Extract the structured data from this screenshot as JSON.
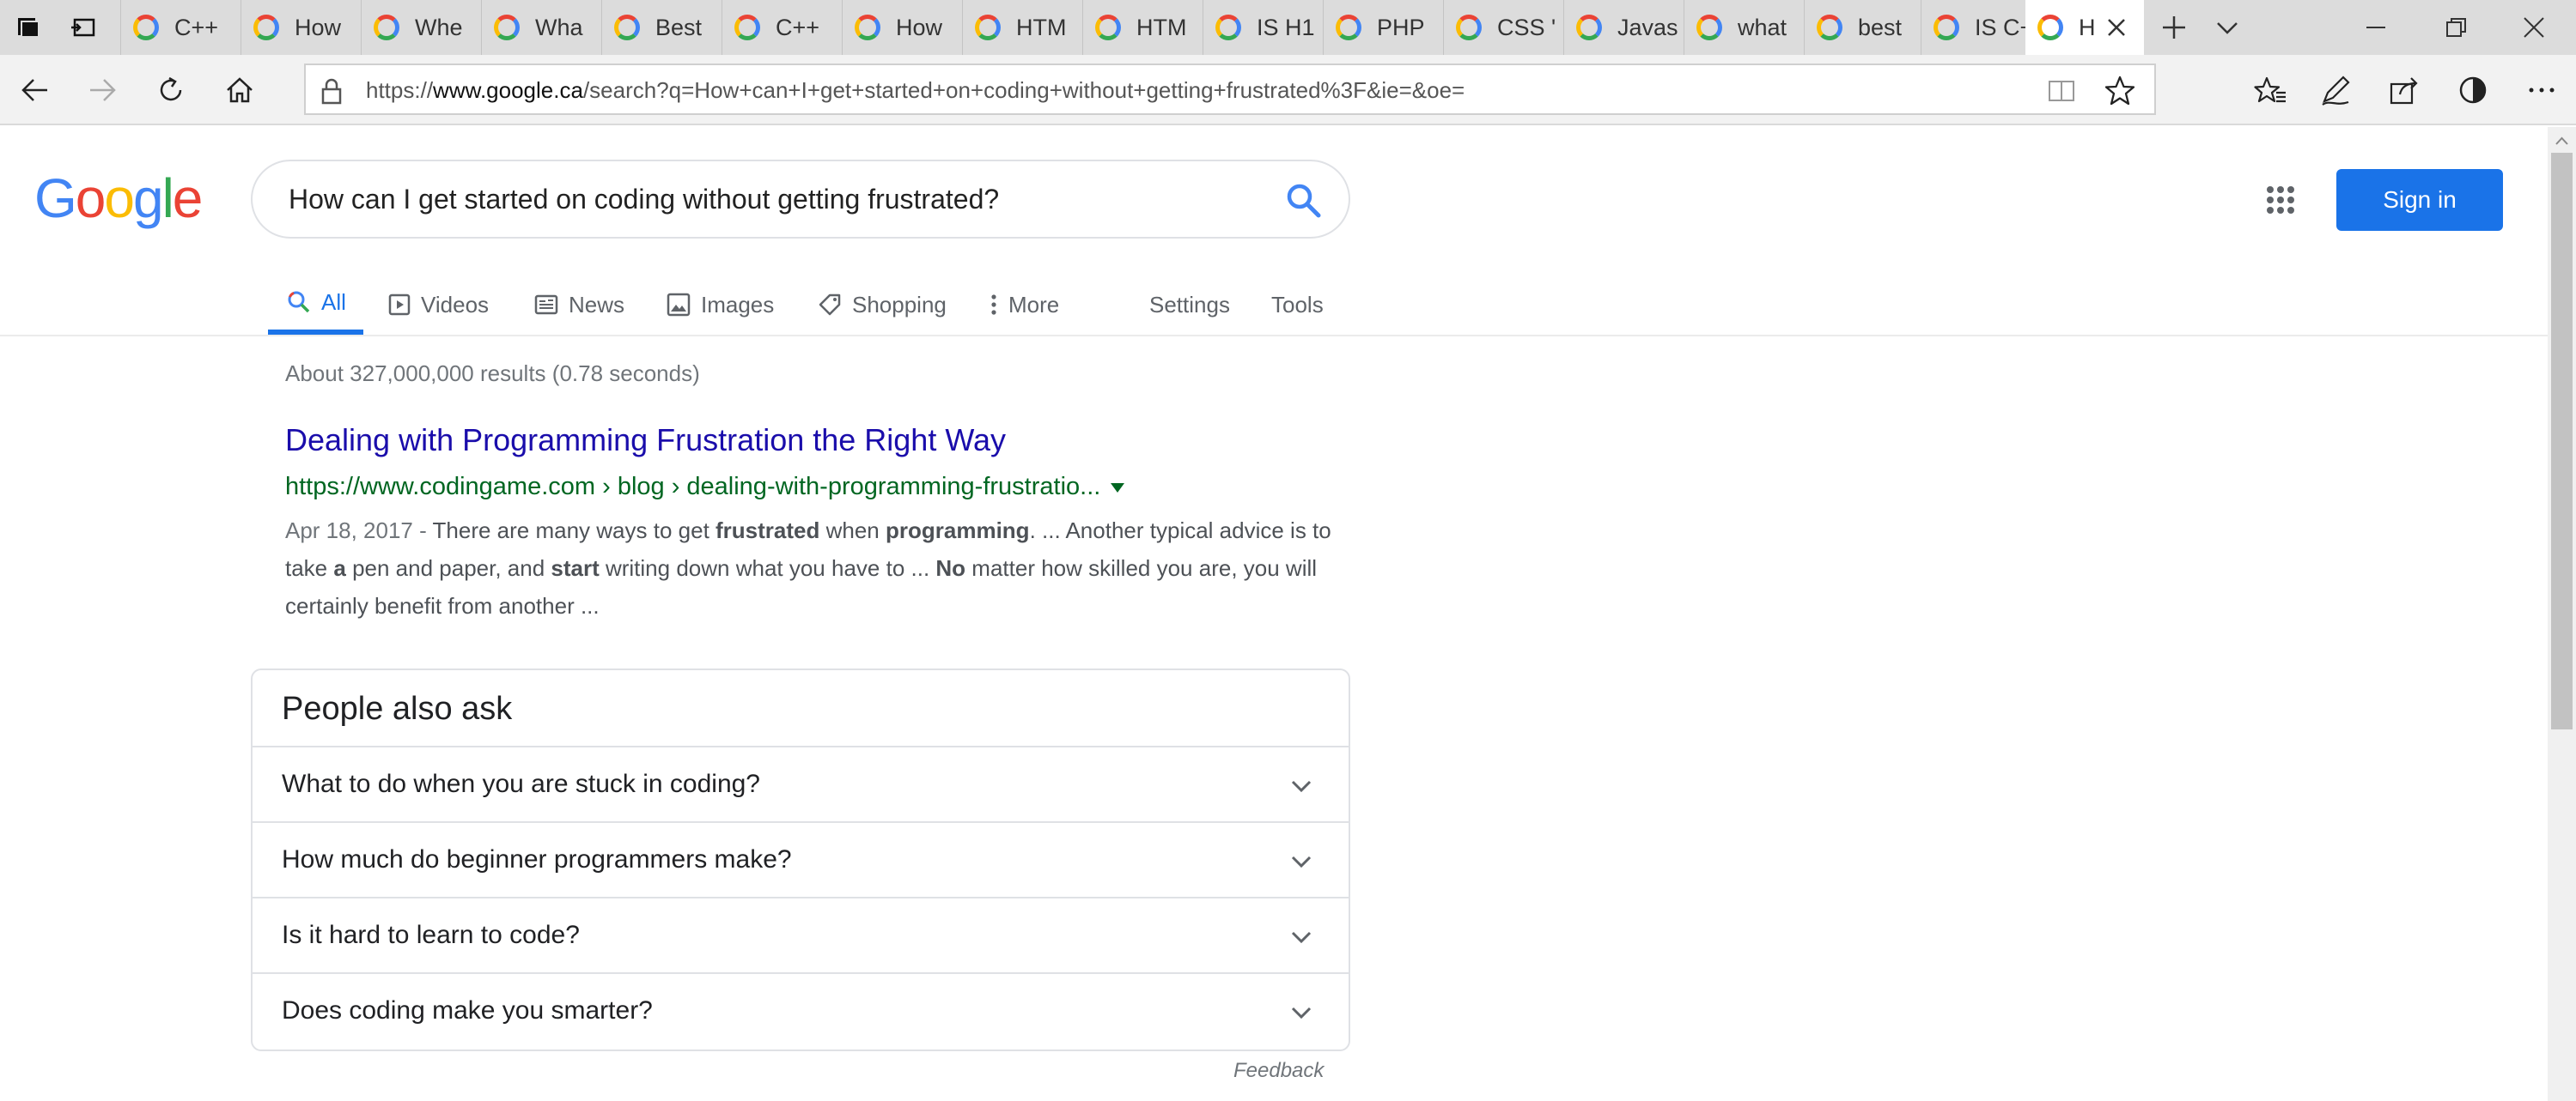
{
  "browser": {
    "tabs": [
      {
        "label": "C++"
      },
      {
        "label": "How"
      },
      {
        "label": "Whe"
      },
      {
        "label": "Wha"
      },
      {
        "label": "Best"
      },
      {
        "label": "C++"
      },
      {
        "label": "How"
      },
      {
        "label": "HTM"
      },
      {
        "label": "HTM"
      },
      {
        "label": "IS H1"
      },
      {
        "label": "PHP"
      },
      {
        "label": "CSS '"
      },
      {
        "label": "Javas"
      },
      {
        "label": "what"
      },
      {
        "label": "best"
      },
      {
        "label": "IS C+"
      }
    ],
    "active_tab_label": "H",
    "url_prefix": "https://",
    "url_domain": "www.google.ca",
    "url_path": "/search?q=How+can+I+get+started+on+coding+without+getting+frustrated%3F&ie=&oe="
  },
  "google": {
    "logo": [
      "G",
      "o",
      "o",
      "g",
      "l",
      "e"
    ],
    "query": "How can I get started on coding without getting frustrated?",
    "sign_in_label": "Sign in",
    "tabs": {
      "all": "All",
      "videos": "Videos",
      "news": "News",
      "images": "Images",
      "shopping": "Shopping",
      "more": "More",
      "settings": "Settings",
      "tools": "Tools"
    },
    "stats": "About 327,000,000 results (0.78 seconds)",
    "result": {
      "title": "Dealing with Programming Frustration the Right Way",
      "url": "https://www.codingame.com › blog › dealing-with-programming-frustratio...",
      "date": "Apr 18, 2017 - ",
      "snippet_parts": [
        "There are many ways to get ",
        "frustrated",
        " when ",
        "programming",
        ". ... Another typical advice is to take ",
        "a",
        " pen and paper, and ",
        "start",
        " writing down what you have to ... ",
        "No",
        " matter how skilled you are, you will certainly benefit from another ..."
      ]
    },
    "people_also_ask": {
      "title": "People also ask",
      "questions": [
        "What to do when you are stuck in coding?",
        "How much do beginner programmers make?",
        "Is it hard to learn to code?",
        "Does coding make you smarter?"
      ]
    },
    "feedback_label": "Feedback"
  },
  "colors": {
    "link": "#1a0dab",
    "url_green": "#006621",
    "accent": "#1a73e8"
  }
}
